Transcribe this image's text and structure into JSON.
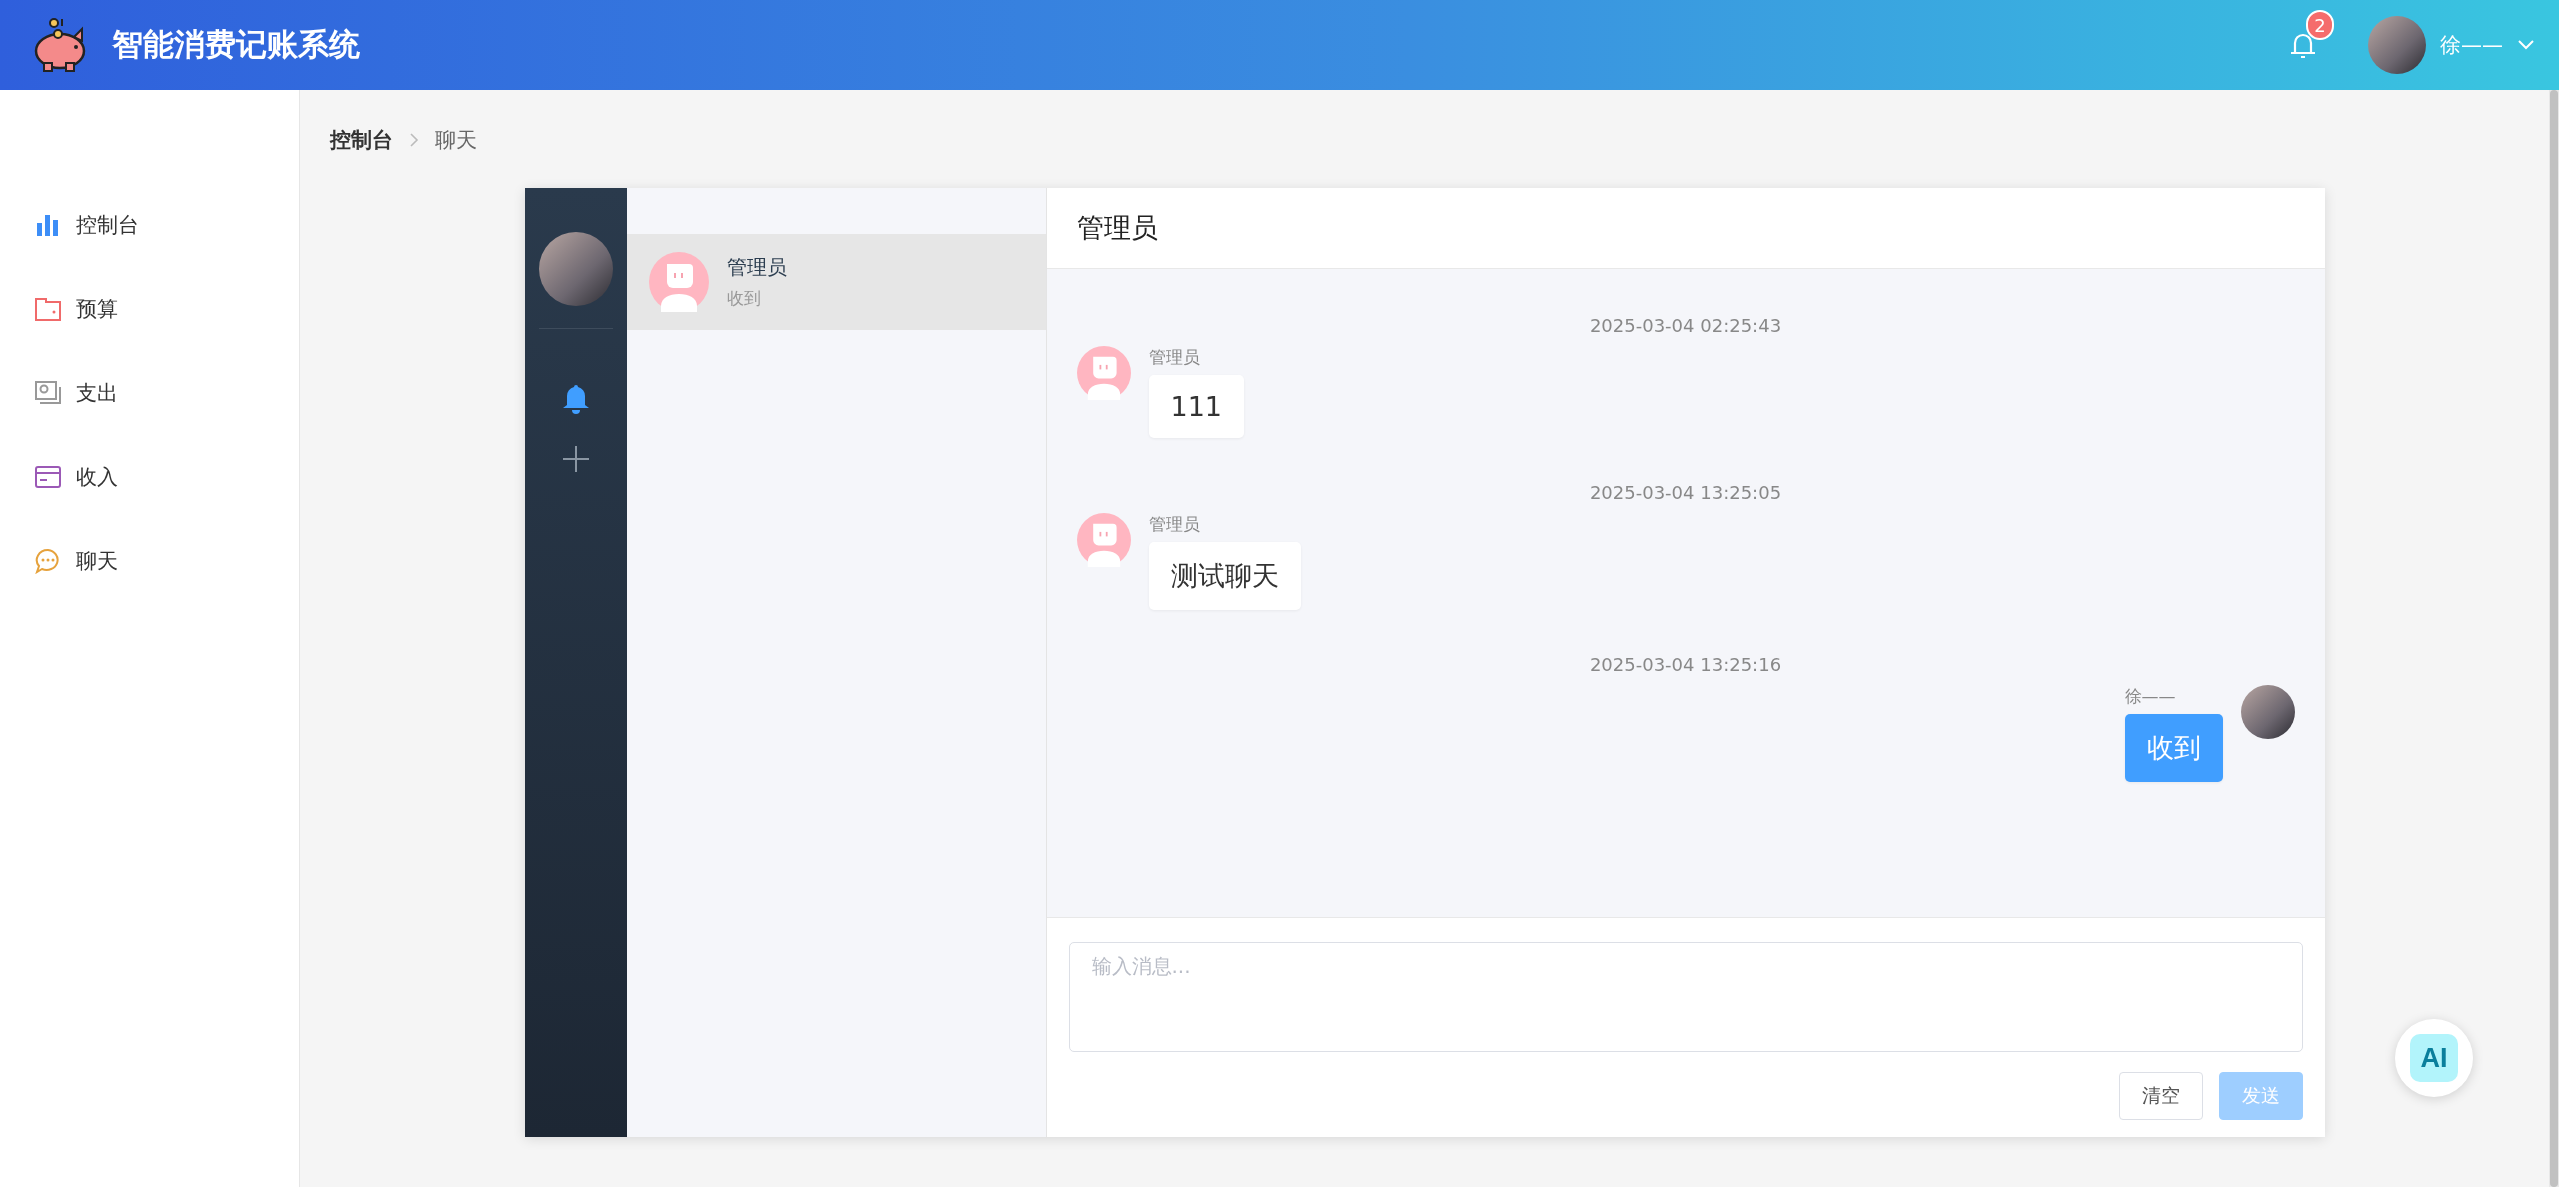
{
  "header": {
    "title": "智能消费记账系统",
    "notification_count": "2",
    "user_name": "徐——"
  },
  "sidebar": {
    "items": [
      {
        "label": "控制台",
        "kind": "chart"
      },
      {
        "label": "预算",
        "kind": "wallet"
      },
      {
        "label": "支出",
        "kind": "cash"
      },
      {
        "label": "收入",
        "kind": "card"
      },
      {
        "label": "聊天",
        "kind": "chat"
      }
    ]
  },
  "breadcrumb": [
    "控制台",
    "聊天"
  ],
  "chat": {
    "conversations": [
      {
        "name": "管理员",
        "preview": "收到",
        "selected": true
      }
    ],
    "title": "管理员",
    "messages": [
      {
        "time": "2025-03-04 02:25:43",
        "sender": "管理员",
        "text": "111",
        "kind": "received"
      },
      {
        "time": "2025-03-04 13:25:05",
        "sender": "管理员",
        "text": "测试聊天",
        "kind": "received"
      },
      {
        "time": "2025-03-04 13:25:16",
        "sender": "徐——",
        "text": "收到",
        "kind": "sent"
      }
    ],
    "input": {
      "placeholder": "输入消息..."
    },
    "buttons": [
      {
        "label": "清空",
        "kind": "clear",
        "disabled": false
      },
      {
        "label": "发送",
        "kind": "send",
        "disabled": true
      }
    ]
  },
  "ai_button": {
    "label": "AI"
  }
}
